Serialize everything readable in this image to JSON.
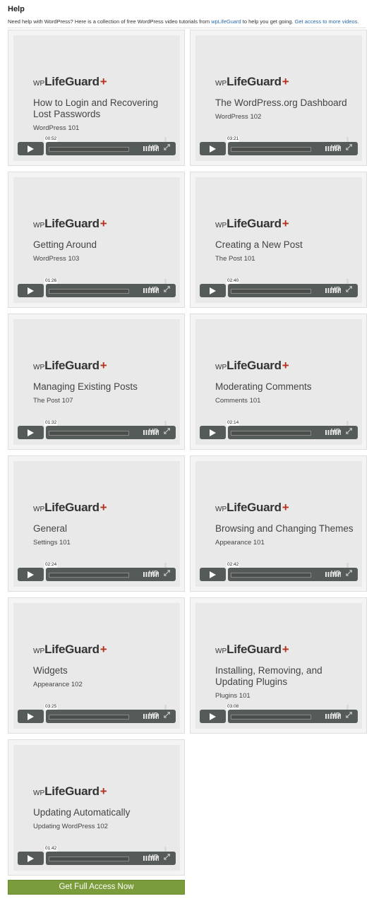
{
  "page": {
    "title": "Help",
    "intro_text": "Need help with WordPress? Here is a collection of free WordPress video tutorials from ",
    "intro_link": "wpLifeGuard",
    "intro_text2": " to help you get going. ",
    "more_link": "Get access to more videos."
  },
  "brand": {
    "wp": "WP",
    "name": "LifeGuard",
    "plus": "+",
    "plus_color": "#b3331f"
  },
  "player": {
    "hd_label": "HD",
    "fullscreen_symbol": "⤢"
  },
  "videos": [
    {
      "title": "How to Login and Recovering Lost Passwords",
      "subtitle": "WordPress 101",
      "time": "00:52"
    },
    {
      "title": "The WordPress.org Dashboard",
      "subtitle": "WordPress 102",
      "time": "03:21"
    },
    {
      "title": "Getting Around",
      "subtitle": "WordPress 103",
      "time": "01:26"
    },
    {
      "title": "Creating a New Post",
      "subtitle": "The Post 101",
      "time": "02:40"
    },
    {
      "title": "Managing Existing Posts",
      "subtitle": "The Post 107",
      "time": "01:32"
    },
    {
      "title": "Moderating Comments",
      "subtitle": "Comments 101",
      "time": "02:14"
    },
    {
      "title": "General",
      "subtitle": "Settings 101",
      "time": "02:24"
    },
    {
      "title": "Browsing and Changing Themes",
      "subtitle": "Appearance 101",
      "time": "02:42"
    },
    {
      "title": "Widgets",
      "subtitle": "Appearance 102",
      "time": "03:25"
    },
    {
      "title": "Installing, Removing, and Updating Plugins",
      "subtitle": "Plugins 101",
      "time": "03:08"
    },
    {
      "title": "Updating Automatically",
      "subtitle": "Updating WordPress 102",
      "time": "01:42"
    }
  ],
  "cta": {
    "label": "Get Full Access Now",
    "color": "#7a9c3a"
  }
}
